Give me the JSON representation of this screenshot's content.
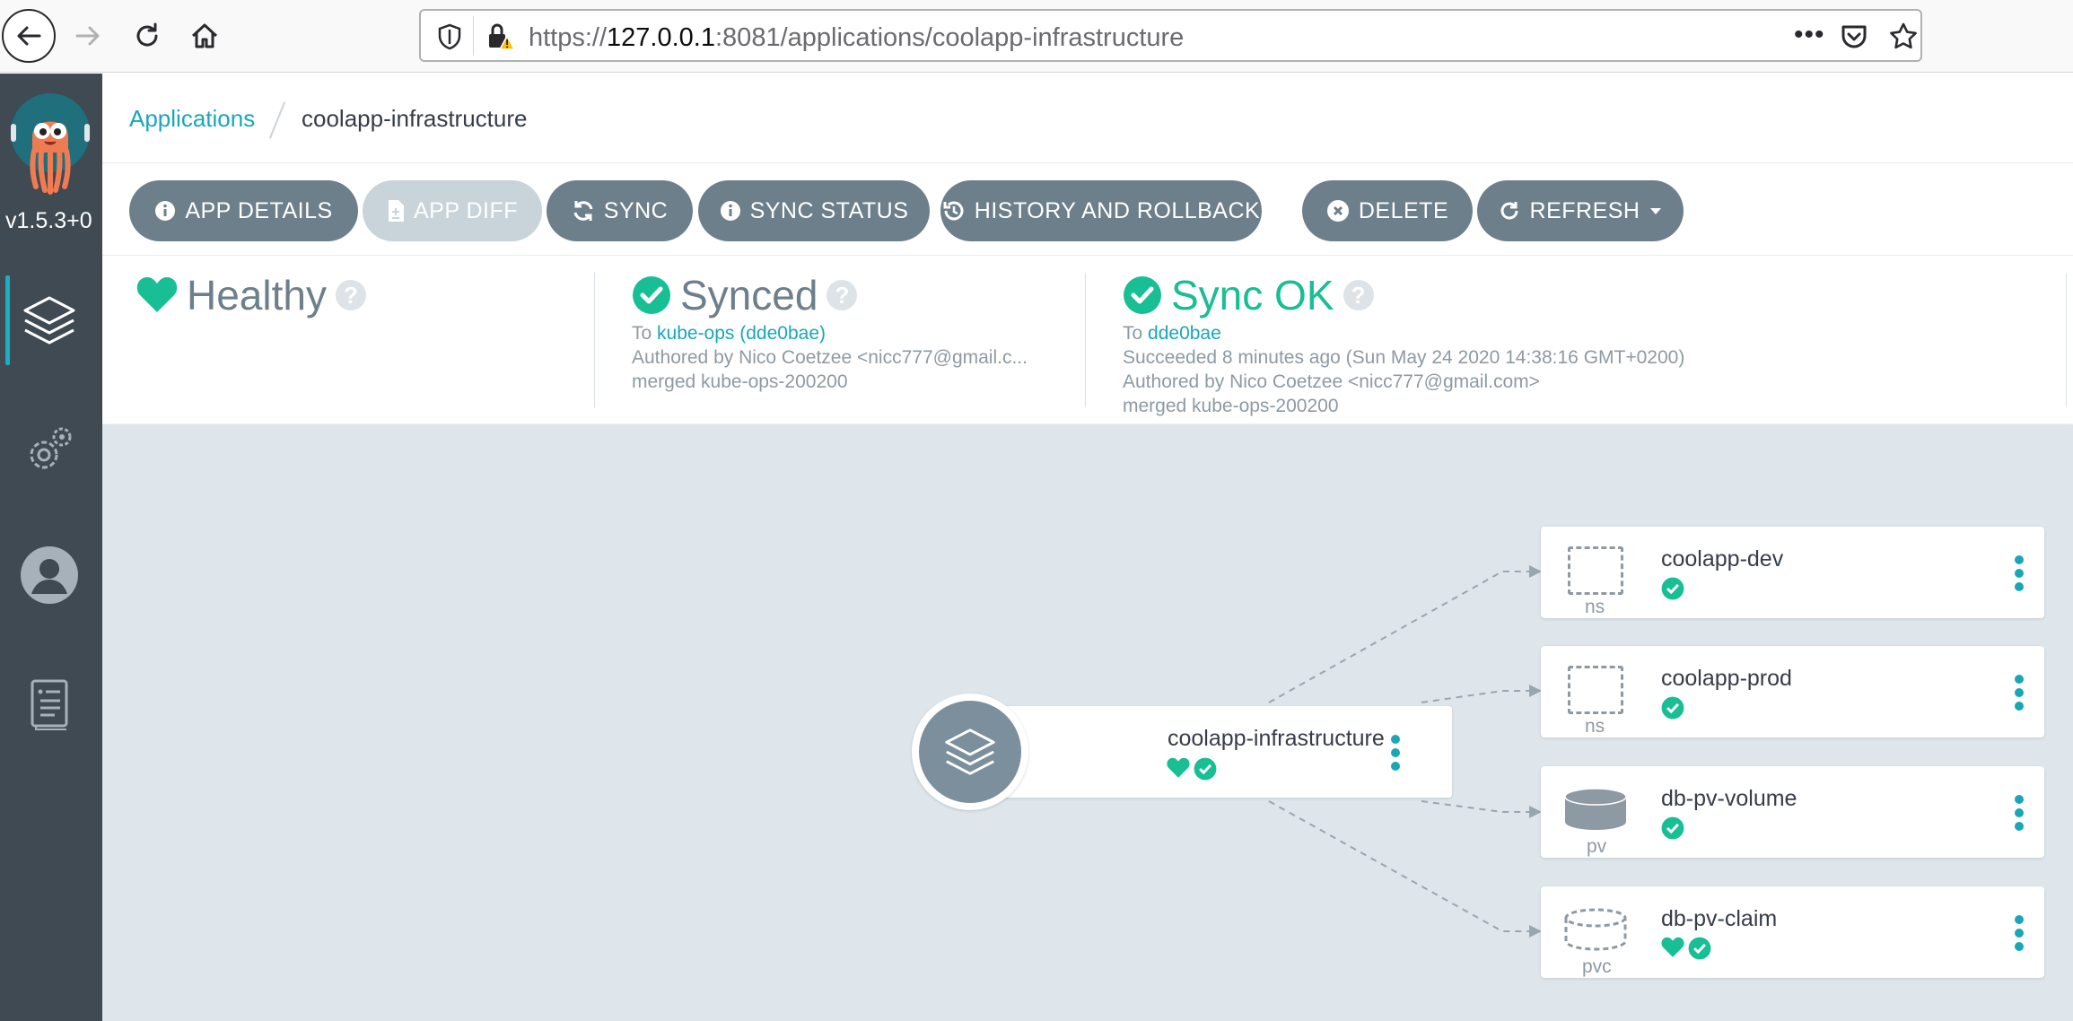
{
  "browser": {
    "url_prefix": "https://",
    "url_host": "127.0.0.1",
    "url_rest": ":8081/applications/coolapp-infrastructure"
  },
  "sidebar": {
    "version": "v1.5.3+0",
    "items": [
      {
        "icon": "layers-icon",
        "label": "Applications"
      },
      {
        "icon": "gears-icon",
        "label": "Settings"
      },
      {
        "icon": "user-icon",
        "label": "User Info"
      },
      {
        "icon": "docs-icon",
        "label": "Documentation"
      }
    ]
  },
  "breadcrumb": {
    "parent": "Applications",
    "current": "coolapp-infrastructure"
  },
  "toolbar": {
    "app_details": "APP DETAILS",
    "app_diff": "APP DIFF",
    "sync": "SYNC",
    "sync_status": "SYNC STATUS",
    "history": "HISTORY AND ROLLBACK",
    "delete": "DELETE",
    "refresh": "REFRESH"
  },
  "status": {
    "health": {
      "title": "Healthy",
      "color": "#18be94"
    },
    "sync": {
      "title": "Synced",
      "to_prefix": "To",
      "to_link": "kube-ops (dde0bae)",
      "author": "Authored by Nico Coetzee <nicc777@gmail.c...",
      "message": "merged kube-ops-200200"
    },
    "operation": {
      "title": "Sync OK",
      "to_prefix": "To",
      "to_link": "dde0bae",
      "succeeded": "Succeeded 8 minutes ago (Sun May 24 2020 14:38:16 GMT+0200)",
      "author": "Authored by Nico Coetzee <nicc777@gmail.com>",
      "message": "merged kube-ops-200200"
    }
  },
  "graph": {
    "root": {
      "name": "coolapp-infrastructure",
      "healthy": true,
      "synced": true
    },
    "resources": [
      {
        "name": "coolapp-dev",
        "kind": "ns",
        "healthy": false,
        "synced": true
      },
      {
        "name": "coolapp-prod",
        "kind": "ns",
        "healthy": false,
        "synced": true
      },
      {
        "name": "db-pv-volume",
        "kind": "pv",
        "healthy": false,
        "synced": true
      },
      {
        "name": "db-pv-claim",
        "kind": "pvc",
        "healthy": true,
        "synced": true
      }
    ]
  },
  "colors": {
    "accent": "#19a7b8",
    "healthy": "#18be94",
    "button": "#6d7f8b",
    "sidebar": "#3f4a53",
    "graph_bg": "#dee6eb"
  }
}
